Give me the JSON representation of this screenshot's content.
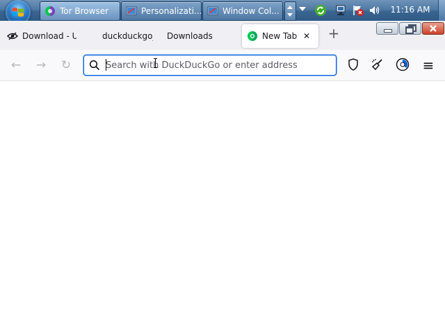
{
  "taskbar": {
    "buttons": [
      {
        "label": "Tor Browser",
        "icon": "tor-browser-icon",
        "active": true
      },
      {
        "label": "Personalizati...",
        "icon": "personalization-icon",
        "active": false
      },
      {
        "label": "Window Col...",
        "icon": "window-color-icon",
        "active": false
      }
    ],
    "clock": "11:16 AM",
    "tray_icons": [
      "sync-icon",
      "network-icon",
      "action-center-icon",
      "volume-icon"
    ]
  },
  "browser": {
    "tabs": [
      {
        "label": "Download - U",
        "icon": "eye-icon"
      },
      {
        "label": "duckduckgo_",
        "icon": ""
      },
      {
        "label": "Downloads",
        "icon": ""
      },
      {
        "label": "New Tab",
        "icon": "tor-onion-icon",
        "active": true
      }
    ],
    "new_tab_symbol": "+",
    "close_symbol": "✕",
    "nav": {
      "back_symbol": "←",
      "forward_symbol": "→",
      "reload_symbol": "↻"
    },
    "address_bar": {
      "placeholder": "Search with DuckDuckGo or enter address",
      "value": ""
    },
    "toolbar_icons": [
      "shield-icon",
      "new-identity-broom-icon",
      "tor-circuit-icon",
      "menu-icon"
    ],
    "menu_symbol": "≡"
  },
  "colors": {
    "taskbar": "#4f7aa6",
    "tabbar": "#f0f0f4",
    "accent": "#0060df",
    "tor_green": "#00c853"
  }
}
